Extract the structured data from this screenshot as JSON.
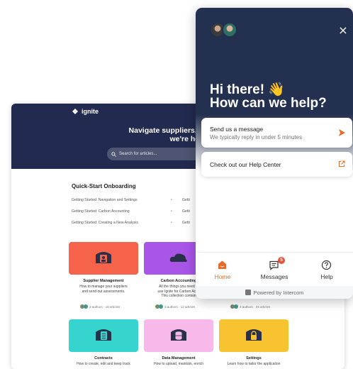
{
  "help_center": {
    "brand": "ignite",
    "headline_line1": "Navigate suppliers, spend, and contract",
    "headline_line2": "we're here to gui",
    "search_placeholder": "Search for articles...",
    "quick_start": {
      "title": "Quick-Start Onboarding",
      "rows": [
        {
          "left": "Getting Started: Navigation and Settings",
          "right": "Getti"
        },
        {
          "left": "Getting Started: Carbon Accounting",
          "right": "Getti"
        },
        {
          "left": "Getting Started: Creating a New Analysis",
          "right": "Getti"
        }
      ]
    },
    "collections": [
      {
        "title": "Supplier Management",
        "desc1": "How to manage your suppliers",
        "desc2": "and send out assessments.",
        "desc3": "",
        "meta": "3 authors · 18 articles",
        "color": "#f4634a"
      },
      {
        "title": "Carbon Accounting",
        "desc1": "All the things you need in",
        "desc2": "use Ignite for Carbon Acco",
        "desc3": "This collection contain",
        "meta": "3 authors · 12 articles",
        "color": "#a855e8"
      },
      {
        "title": "",
        "desc1": "",
        "desc2": "",
        "desc3": "",
        "meta": "3 authors · 24 articles",
        "color": "#ffffff"
      },
      {
        "title": "Contracts",
        "desc1": "How to create, edit and keep track",
        "desc2": "",
        "desc3": "",
        "meta": "",
        "color": "#35d4cf"
      },
      {
        "title": "Data Management",
        "desc1": "How to upload, maintain, enrich",
        "desc2": "",
        "desc3": "",
        "meta": "",
        "color": "#f7b8ea"
      },
      {
        "title": "Settings",
        "desc1": "Learn how to tailor the application",
        "desc2": "",
        "desc3": "",
        "meta": "",
        "color": "#f7c331"
      }
    ]
  },
  "messenger": {
    "greeting_line1": "Hi there! 👋",
    "greeting_line2": "How can we help?",
    "send_card": {
      "title": "Send us a message",
      "subtitle": "We typically reply in under 5 minutes"
    },
    "help_card": {
      "title": "Check out our Help Center"
    },
    "nav": [
      {
        "label": "Home",
        "icon": "home-icon"
      },
      {
        "label": "Messages",
        "icon": "messages-icon",
        "badge": "5"
      },
      {
        "label": "Help",
        "icon": "help-icon"
      }
    ],
    "powered_by": "Powered by Intercom",
    "accent": "#e76b2a",
    "header_color": "#23304f"
  }
}
